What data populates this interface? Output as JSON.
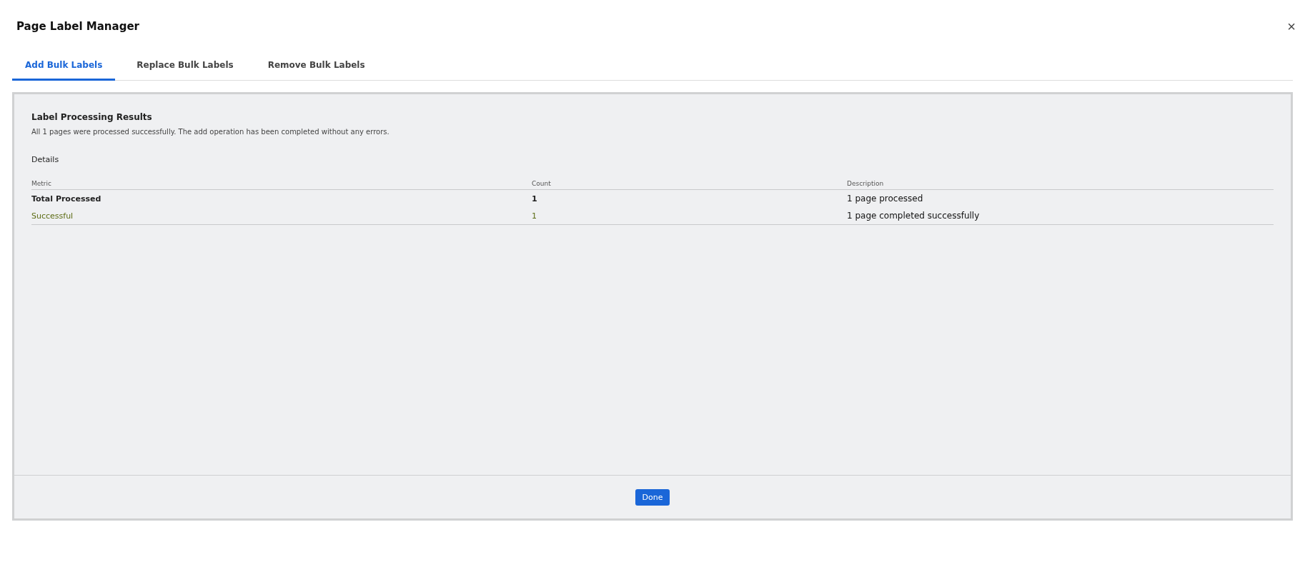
{
  "window": {
    "title": "Page Label Manager",
    "close": "×"
  },
  "tabs": [
    {
      "label": "Add Bulk Labels",
      "selected": true
    },
    {
      "label": "Replace Bulk Labels",
      "selected": false
    },
    {
      "label": "Remove Bulk Labels",
      "selected": false
    }
  ],
  "results": {
    "title": "Label Processing Results",
    "message": "All 1 pages were processed successfully. The add operation has been completed without any errors.",
    "details_heading": "Details",
    "table": {
      "columns": [
        "Metric",
        "Count",
        "Description"
      ],
      "rows": [
        {
          "kind": "total",
          "cells": [
            "Total Processed",
            "1",
            "1 page processed"
          ]
        },
        {
          "kind": "success",
          "cells": [
            "Successful",
            "1",
            "1 page completed successfully"
          ]
        }
      ]
    }
  },
  "buttons": [
    "Done"
  ]
}
